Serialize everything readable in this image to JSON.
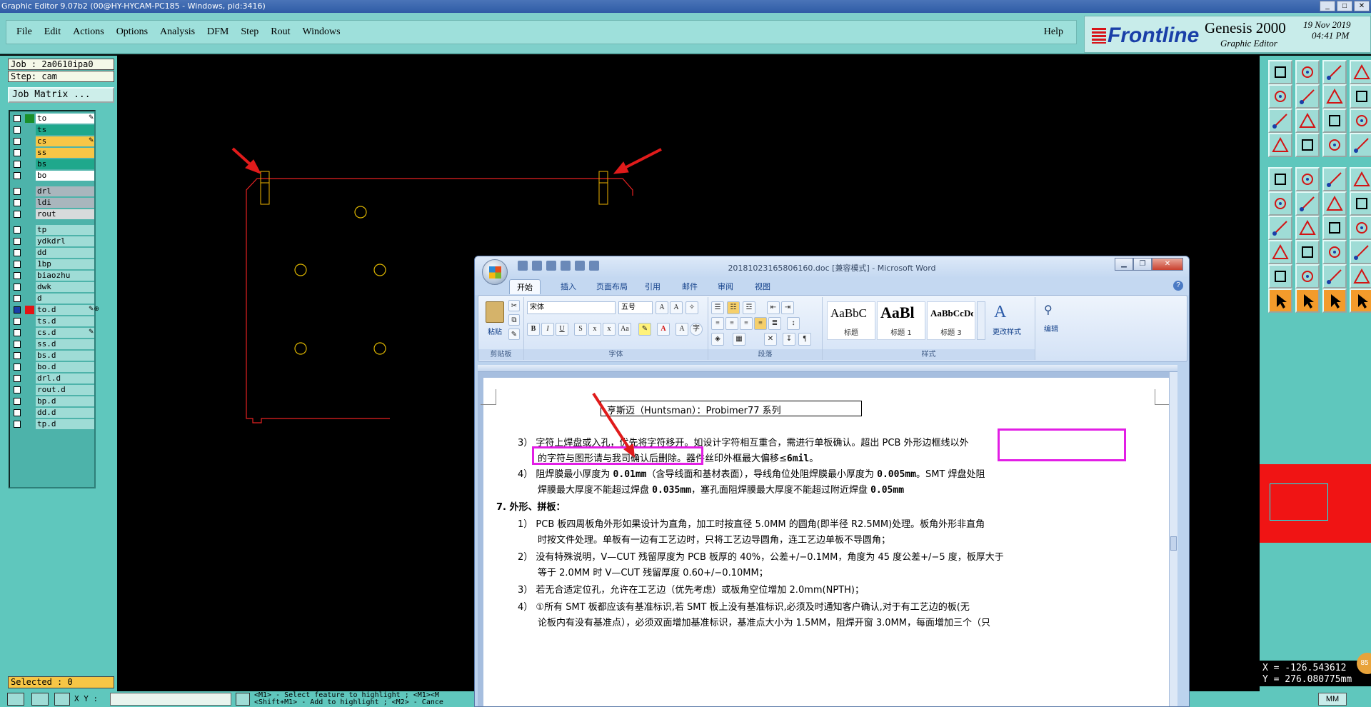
{
  "window": {
    "title": "Graphic Editor 9.07b2 (00@HY-HYCAM-PC185 - Windows, pid:3416)",
    "controls": [
      "_",
      "□",
      "✕"
    ]
  },
  "menu": {
    "items": [
      "File",
      "Edit",
      "Actions",
      "Options",
      "Analysis",
      "DFM",
      "Step",
      "Rout",
      "Windows"
    ],
    "help": "Help"
  },
  "brand": {
    "logo": "Frontline",
    "product": "Genesis 2000",
    "subtitle": "Graphic Editor",
    "date": "19 Nov 2019",
    "time": "04:41 PM"
  },
  "panel": {
    "job": "Job : 2a0610ipa0",
    "step": "Step: cam",
    "job_matrix": "Job Matrix ...",
    "selected": "Selected : 0"
  },
  "layers": [
    {
      "name": "to",
      "color": "#ffffff",
      "swatch": "#1a8f2a",
      "flag": "✎"
    },
    {
      "name": "ts",
      "color": "#1fa88c",
      "swatch": "",
      "flag": ""
    },
    {
      "name": "cs",
      "color": "#f7c646",
      "swatch": "",
      "flag": "✎"
    },
    {
      "name": "ss",
      "color": "#f7c646",
      "swatch": "",
      "flag": ""
    },
    {
      "name": "bs",
      "color": "#1fa88c",
      "swatch": "",
      "flag": ""
    },
    {
      "name": "bo",
      "color": "#ffffff",
      "swatch": "",
      "flag": ""
    },
    {
      "name": "drl",
      "color": "#a9b6bd",
      "swatch": "",
      "flag": "",
      "gap": true
    },
    {
      "name": "ldi",
      "color": "#a9b6bd",
      "swatch": "",
      "flag": ""
    },
    {
      "name": "rout",
      "color": "#d7dadb",
      "swatch": "",
      "flag": ""
    },
    {
      "name": "tp",
      "color": "#9fdcd6",
      "swatch": "",
      "flag": "",
      "gap": true
    },
    {
      "name": "ydkdrl",
      "color": "#9fdcd6",
      "swatch": "",
      "flag": ""
    },
    {
      "name": "dd",
      "color": "#9fdcd6",
      "swatch": "",
      "flag": ""
    },
    {
      "name": "1bp",
      "color": "#9fdcd6",
      "swatch": "",
      "flag": ""
    },
    {
      "name": "biaozhu",
      "color": "#9fdcd6",
      "swatch": "",
      "flag": ""
    },
    {
      "name": "dwk",
      "color": "#9fdcd6",
      "swatch": "",
      "flag": ""
    },
    {
      "name": "d",
      "color": "#9fdcd6",
      "swatch": "",
      "flag": ""
    },
    {
      "name": "to.d",
      "color": "#9fdcd6",
      "swatch": "#e31414",
      "flag": "✎⊕",
      "active": true
    },
    {
      "name": "ts.d",
      "color": "#9fdcd6",
      "swatch": "",
      "flag": ""
    },
    {
      "name": "cs.d",
      "color": "#9fdcd6",
      "swatch": "",
      "flag": "✎"
    },
    {
      "name": "ss.d",
      "color": "#9fdcd6",
      "swatch": "",
      "flag": ""
    },
    {
      "name": "bs.d",
      "color": "#9fdcd6",
      "swatch": "",
      "flag": ""
    },
    {
      "name": "bo.d",
      "color": "#9fdcd6",
      "swatch": "",
      "flag": ""
    },
    {
      "name": "drl.d",
      "color": "#9fdcd6",
      "swatch": "",
      "flag": ""
    },
    {
      "name": "rout.d",
      "color": "#9fdcd6",
      "swatch": "",
      "flag": ""
    },
    {
      "name": "bp.d",
      "color": "#9fdcd6",
      "swatch": "",
      "flag": ""
    },
    {
      "name": "dd.d",
      "color": "#9fdcd6",
      "swatch": "",
      "flag": ""
    },
    {
      "name": "tp.d",
      "color": "#9fdcd6",
      "swatch": "",
      "flag": ""
    }
  ],
  "coords": {
    "x": "X = -126.543612",
    "y": "Y = 276.080775mm"
  },
  "status": {
    "xy_label": "X Y :",
    "prompt1": "<M1> - Select feature to highlight ; <M1><M",
    "prompt2": "<Shift+M1> - Add to highlight ; <M2> - Cance",
    "unit": "MM",
    "badge": "85"
  },
  "word": {
    "title": "20181023165806160.doc [兼容模式] - Microsoft Word",
    "tabs": [
      "开始",
      "插入",
      "页面布局",
      "引用",
      "邮件",
      "审阅",
      "视图"
    ],
    "font_name": "宋体",
    "font_size": "五号",
    "paste": "粘贴",
    "groups": [
      "剪贴板",
      "字体",
      "段落",
      "样式"
    ],
    "styles": [
      {
        "sample": "AaBbC",
        "label": "标题"
      },
      {
        "sample": "AaBl",
        "label": "标题 1"
      },
      {
        "sample": "AaBbCcDc",
        "label": "标题 3"
      }
    ],
    "change_styles": "更改样式",
    "edit": "编辑",
    "doc": {
      "box_text": "亨斯迈（Huntsman）：Probimer77 系列",
      "l1a": "3）  字符上焊盘或入孔，优先将字符移开。如设计字符相互重合，需进行单板确认。",
      "l1b": "超出 PCB 外形边框线以外",
      "l2a": "的字符与图形请与我司确认后删除。",
      "l2b": "器件丝印外框最大偏移≤",
      "l2c": "6mil",
      "l2d": "。",
      "l3a": "4）  阻焊膜最小厚度为 ",
      "l3b": "0.01mm",
      "l3c": "（含导线面和基材表面），导线角位处阻焊膜最小厚度为 ",
      "l3d": "0.005mm",
      "l3e": "。SMT 焊盘处阻",
      "l4a": "焊膜最大厚度不能超过焊盘 ",
      "l4b": "0.035mm",
      "l4c": "，塞孔面阻焊膜最大厚度不能超过附近焊盘 ",
      "l4d": "0.05mm",
      "h7": "7.   外形、拼板：",
      "p1a": "1）  PCB 板四周板角外形如果设计为直角，加工时按直径 5.0MM 的圆角(即半径 R2.5MM)处理。板角外形非直角",
      "p1b": "时按文件处理。单板有一边有工艺边时，只将工艺边导圆角，连工艺边单板不导圆角；",
      "p2a": "2）  没有特殊说明，V—CUT 残留厚度为 PCB 板厚的 40%，公差+/−0.1MM，角度为 45 度公差+/−5 度，板厚大于",
      "p2b": "等于 2.0MM 时 V—CUT 残留厚度 0.60+/−0.10MM；",
      "p3": "3）  若无合适定位孔，允许在工艺边（优先考虑）或板角空位增加 2.0mm(NPTH)；",
      "p4": "4）  ①所有 SMT 板都应该有基准标识,若 SMT 板上没有基准标识,必须及时通知客户确认,对于有工艺边的板(无",
      "p5": "论板内有没有基准点），必须双面增加基准标识，基准点大小为 1.5MM，阻焊开窗 3.0MM，每面增加三个（只"
    }
  }
}
